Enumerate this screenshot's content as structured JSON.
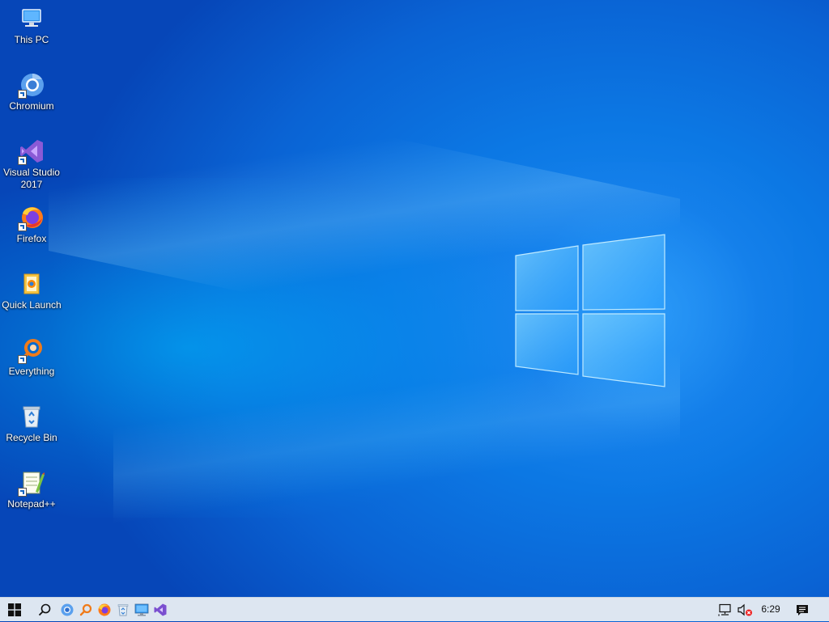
{
  "desktop": {
    "icons": [
      {
        "label": "This PC",
        "icon": "this-pc-icon",
        "shortcut": false
      },
      {
        "label": "Chromium",
        "icon": "chromium-icon",
        "shortcut": true
      },
      {
        "label": "Visual Studio 2017",
        "icon": "visual-studio-icon",
        "shortcut": true
      },
      {
        "label": "Firefox",
        "icon": "firefox-icon",
        "shortcut": true
      },
      {
        "label": "Quick Launch",
        "icon": "quick-launch-icon",
        "shortcut": false
      },
      {
        "label": "Everything",
        "icon": "everything-icon",
        "shortcut": true
      },
      {
        "label": "Recycle Bin",
        "icon": "recycle-bin-icon",
        "shortcut": false
      },
      {
        "label": "Notepad++",
        "icon": "notepad-plus-plus-icon",
        "shortcut": true
      }
    ],
    "wallpaper": "windows-10-hero",
    "colors": {
      "wallpaper_base": "#0a63d4",
      "wallpaper_glow": "#00b4ff"
    }
  },
  "taskbar": {
    "pinned": [
      {
        "name": "start",
        "icon": "windows-start-icon"
      },
      {
        "name": "search",
        "icon": "search-icon"
      },
      {
        "name": "chromium",
        "icon": "chromium-icon"
      },
      {
        "name": "everything",
        "icon": "everything-icon"
      },
      {
        "name": "firefox",
        "icon": "firefox-icon"
      },
      {
        "name": "recycle-bin",
        "icon": "recycle-bin-icon"
      },
      {
        "name": "this-pc",
        "icon": "monitor-icon"
      },
      {
        "name": "visual-studio",
        "icon": "visual-studio-icon"
      }
    ],
    "tray": {
      "network_icon": "network-disconnected-icon",
      "volume_icon": "volume-muted-icon",
      "clock": "6:29",
      "notifications_icon": "action-center-icon"
    },
    "colors": {
      "background": "#dde6f1"
    }
  }
}
